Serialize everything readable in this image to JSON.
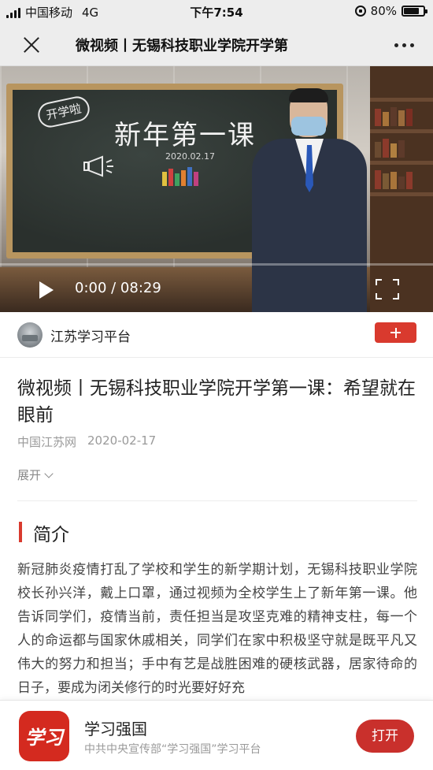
{
  "status_bar": {
    "carrier": "中国移动",
    "network": "4G",
    "time": "下午7:54",
    "battery_percent_label": "80%",
    "battery_level": 0.8
  },
  "nav": {
    "close_icon": "close-icon",
    "title": "微视频丨无锡科技职业学院开学第",
    "more_icon": "more-dots-icon"
  },
  "video": {
    "chalkboard_tag": "开学啦",
    "chalkboard_title": "新年第一课",
    "chalkboard_date": "2020.02.17",
    "time_display": "0:00 / 08:29",
    "play_icon": "play-icon",
    "fullscreen_icon": "fullscreen-icon",
    "progress": 0
  },
  "channel": {
    "name": "江苏学习平台",
    "follow_icon": "plus-icon"
  },
  "article": {
    "title": "微视频丨无锡科技职业学院开学第一课：希望就在眼前",
    "source": "中国江苏网",
    "date": "2020-02-17",
    "expand_label": "展开",
    "section_title": "简介",
    "body": "新冠肺炎疫情打乱了学校和学生的新学期计划，无锡科技职业学院校长孙兴洋，戴上口罩，通过视频为全校学生上了新年第一课。他告诉同学们，疫情当前，责任担当是攻坚克难的精神支柱，每一个人的命运都与国家休戚相关，同学们在家中积极坚守就是既平凡又伟大的努力和担当；手中有艺是战胜困难的硬核武器，居家待命的日子，要成为闭关修行的时光要好好充"
  },
  "app_banner": {
    "logo_text": "学习",
    "app_name": "学习强国",
    "subtitle": "中共中央宣传部“学习强国”学习平台",
    "open_label": "打开"
  },
  "colors": {
    "accent_red": "#d93a2e",
    "open_button": "#c9302c",
    "nav_bg": "#ededed"
  }
}
